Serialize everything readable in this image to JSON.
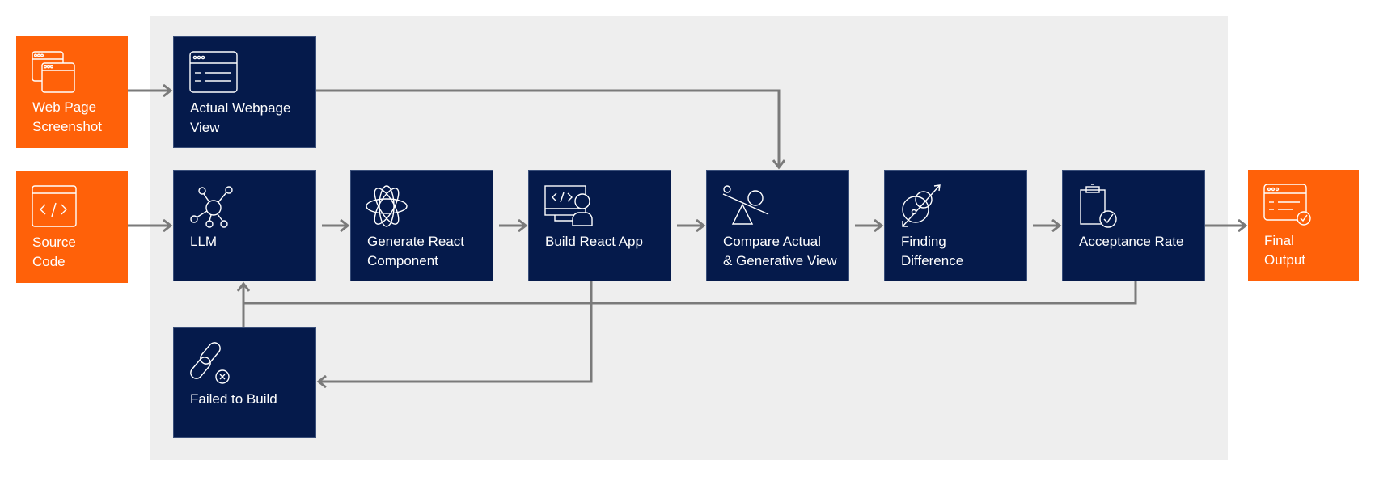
{
  "colors": {
    "input_output": "#ff6109",
    "process": "#051a4b",
    "background_panel": "#eeeeee",
    "connector": "#7a7a7a"
  },
  "inputs": [
    {
      "label": "Web Page\nScreenshot",
      "icon": "browser-windows-icon"
    },
    {
      "label": "Source\nCode",
      "icon": "code-window-icon"
    }
  ],
  "steps": {
    "actual_view": {
      "label": "Actual Webpage\nView",
      "icon": "webpage-icon"
    },
    "llm": {
      "label": "LLM",
      "icon": "network-nodes-icon"
    },
    "generate": {
      "label": "Generate React\nComponent",
      "icon": "react-atom-icon"
    },
    "build": {
      "label": "Build React App",
      "icon": "monitor-user-code-icon"
    },
    "compare": {
      "label": "Compare Actual\n& Generative View",
      "icon": "balance-scale-icon"
    },
    "finding": {
      "label": "Finding\nDifference",
      "icon": "overlapping-circles-icon"
    },
    "acceptance": {
      "label": "Acceptance Rate",
      "icon": "clipboard-check-icon"
    },
    "failed": {
      "label": "Failed to Build",
      "icon": "broken-link-icon"
    }
  },
  "output": {
    "label": "Final\nOutput",
    "icon": "webpage-check-icon"
  }
}
